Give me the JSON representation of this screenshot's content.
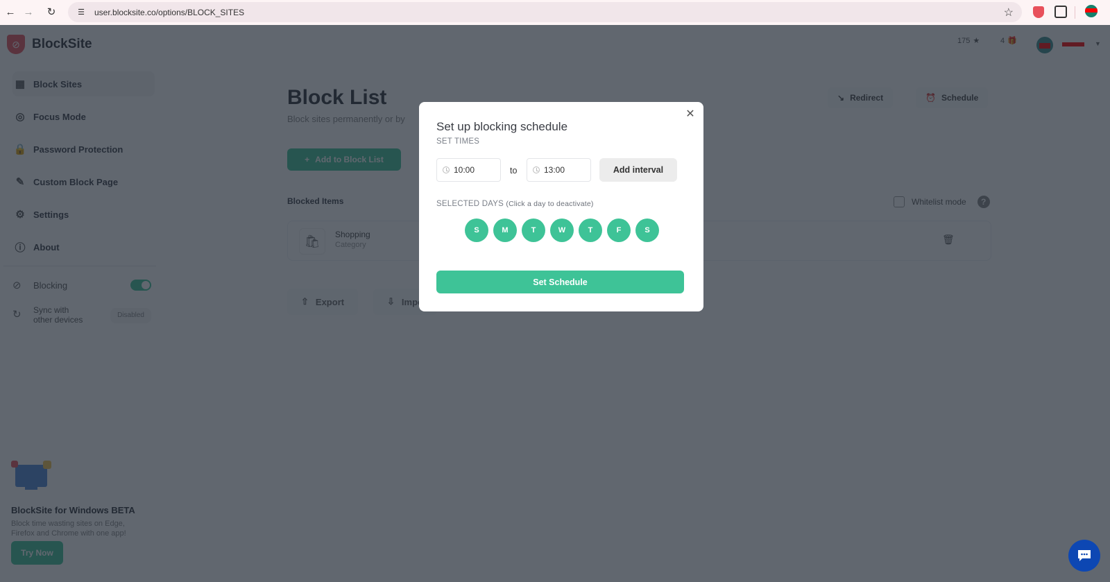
{
  "browser": {
    "url": "user.blocksite.co/options/BLOCK_SITES",
    "back_icon": "arrow-left-icon",
    "forward_icon": "arrow-right-icon",
    "reload_icon": "reload-icon",
    "bookmark_icon": "star-icon"
  },
  "app": {
    "name": "BlockSite",
    "stats": {
      "stars": "175",
      "gifts": "4"
    }
  },
  "sidebar": {
    "items": [
      {
        "label": "Block Sites",
        "icon": "block-sites-icon",
        "active": true
      },
      {
        "label": "Focus Mode",
        "icon": "focus-icon"
      },
      {
        "label": "Password Protection",
        "icon": "lock-icon"
      },
      {
        "label": "Custom Block Page",
        "icon": "edit-page-icon"
      },
      {
        "label": "Settings",
        "icon": "gear-icon"
      },
      {
        "label": "About",
        "icon": "info-icon"
      }
    ],
    "blocking_label": "Blocking",
    "blocking_on": true,
    "sync_label_1": "Sync with",
    "sync_label_2": "other devices",
    "sync_status": "Disabled",
    "promo": {
      "title": "BlockSite for Windows BETA",
      "text": "Block time wasting sites on Edge, Firefox and Chrome with one app!",
      "button": "Try Now"
    }
  },
  "main": {
    "title": "Block List",
    "subtitle": "Block sites permanently or by",
    "add_button": "Add to Block List",
    "redirect_button": "Redirect",
    "schedule_button": "Schedule",
    "blocked_items_label": "Blocked Items",
    "whitelist_label": "Whitelist mode",
    "blocked_items": [
      {
        "name": "Shopping",
        "type": "Category"
      }
    ],
    "export_label": "Export",
    "import_label": "Impo"
  },
  "modal": {
    "title": "Set up blocking schedule",
    "set_times_label": "SET TIMES",
    "from_time": "10:00",
    "to_label": "to",
    "to_time": "13:00",
    "add_interval": "Add interval",
    "selected_days_label": "SELECTED DAYS",
    "selected_days_hint": "(Click a day to deactivate)",
    "days": [
      "S",
      "M",
      "T",
      "W",
      "T",
      "F",
      "S"
    ],
    "set_schedule": "Set Schedule",
    "accent": "#3ec397"
  }
}
